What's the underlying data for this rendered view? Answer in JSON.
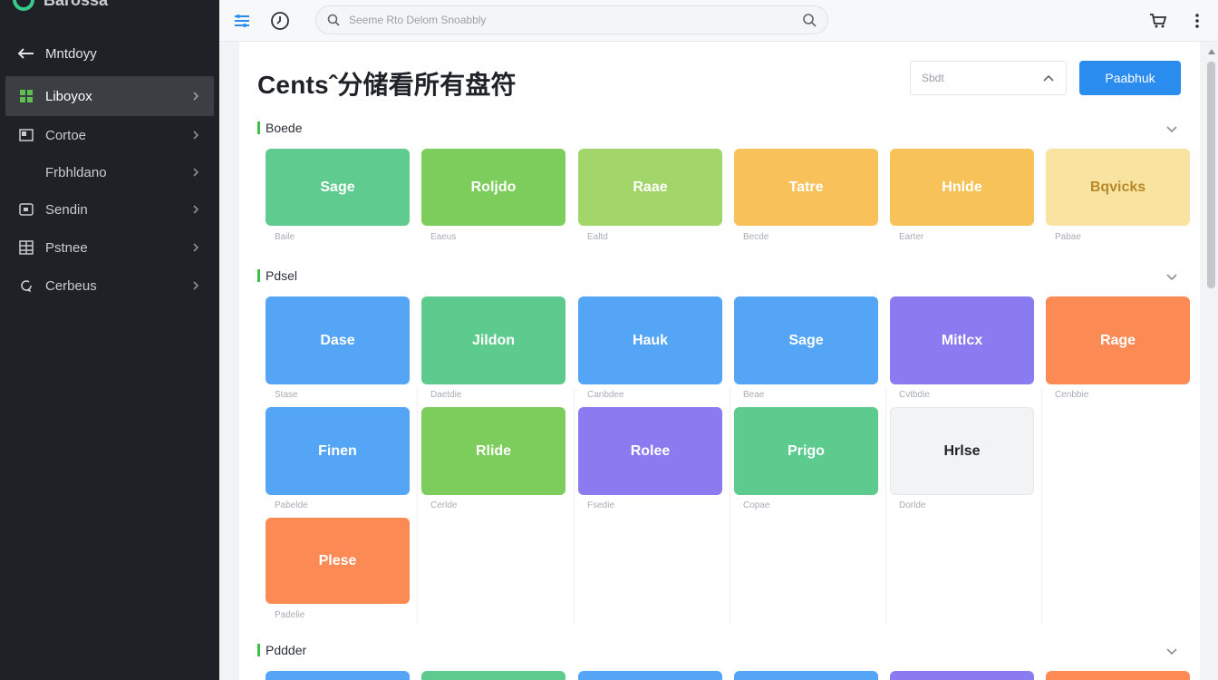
{
  "sidebar": {
    "brand": "Barossa",
    "back_label": "Mntdoyy",
    "items": [
      {
        "label": "Liboyox",
        "icon": "grid-plus-icon",
        "active": true
      },
      {
        "label": "Cortoe",
        "icon": "grid-icon"
      },
      {
        "label": "Frbhldano",
        "icon": "",
        "sub": true
      },
      {
        "label": "Sendin",
        "icon": "window-icon"
      },
      {
        "label": "Pstnee",
        "icon": "building-icon"
      },
      {
        "label": "Cerbeus",
        "icon": "refresh-icon"
      }
    ]
  },
  "topbar": {
    "search_placeholder": "Seeme Rto Delom Snoabbly"
  },
  "main": {
    "title": "Centsˆ分储看所有盘符",
    "select_value": "Sbdt",
    "primary_button": "Paabhuk",
    "sections": [
      {
        "title": "Boede"
      },
      {
        "title": "Pdsel"
      },
      {
        "title": "Pddder"
      }
    ],
    "row1": [
      {
        "label": "Sage",
        "caption": "Baile",
        "color": "#5fcb8f"
      },
      {
        "label": "Roljdo",
        "caption": "Eaeus",
        "color": "#7ccd5c"
      },
      {
        "label": "Raae",
        "caption": "Ealtd",
        "color": "#a3d66a"
      },
      {
        "label": "Tatre",
        "caption": "Becde",
        "color": "#f8c15a"
      },
      {
        "label": "Hnlde",
        "caption": "Earter",
        "color": "#f7c257"
      },
      {
        "label": "Bqvicks",
        "caption": "Pabae",
        "color": "#f9e3a0"
      }
    ],
    "row2": [
      {
        "label": "Dase",
        "caption": "Stase",
        "color": "#55a5f7"
      },
      {
        "label": "Jildon",
        "caption": "Daetdie",
        "color": "#5ecb8e"
      },
      {
        "label": "Hauk",
        "caption": "Canbdee",
        "color": "#55a5f7"
      },
      {
        "label": "Sage",
        "caption": "Beae",
        "color": "#55a5f7"
      },
      {
        "label": "Mitlcx",
        "caption": "Cvtbdie",
        "color": "#8a7cf0"
      },
      {
        "label": "Rage",
        "caption": "Cenbbie",
        "color": "#fb8a55"
      }
    ],
    "row3": [
      {
        "label": "Finen",
        "caption": "Pabelde",
        "color": "#55a5f7"
      },
      {
        "label": "Rlide",
        "caption": "Cerlde",
        "color": "#7ccd5c"
      },
      {
        "label": "Rolee",
        "caption": "Fsedie",
        "color": "#8a7cf0"
      },
      {
        "label": "Prigo",
        "caption": "Copae",
        "color": "#5ecb8e"
      },
      {
        "label": "Hrlse",
        "caption": "Dorlde",
        "color": "#f2f3f4",
        "text_color": "#1f2328"
      }
    ],
    "row4": [
      {
        "label": "Plese",
        "caption": "Padelie",
        "color": "#fb8a55"
      }
    ],
    "row5_colors": [
      "#55a5f7",
      "#5ecb8e",
      "#55a5f7",
      "#55a5f7",
      "#8a7cf0",
      "#fb8a55"
    ]
  }
}
